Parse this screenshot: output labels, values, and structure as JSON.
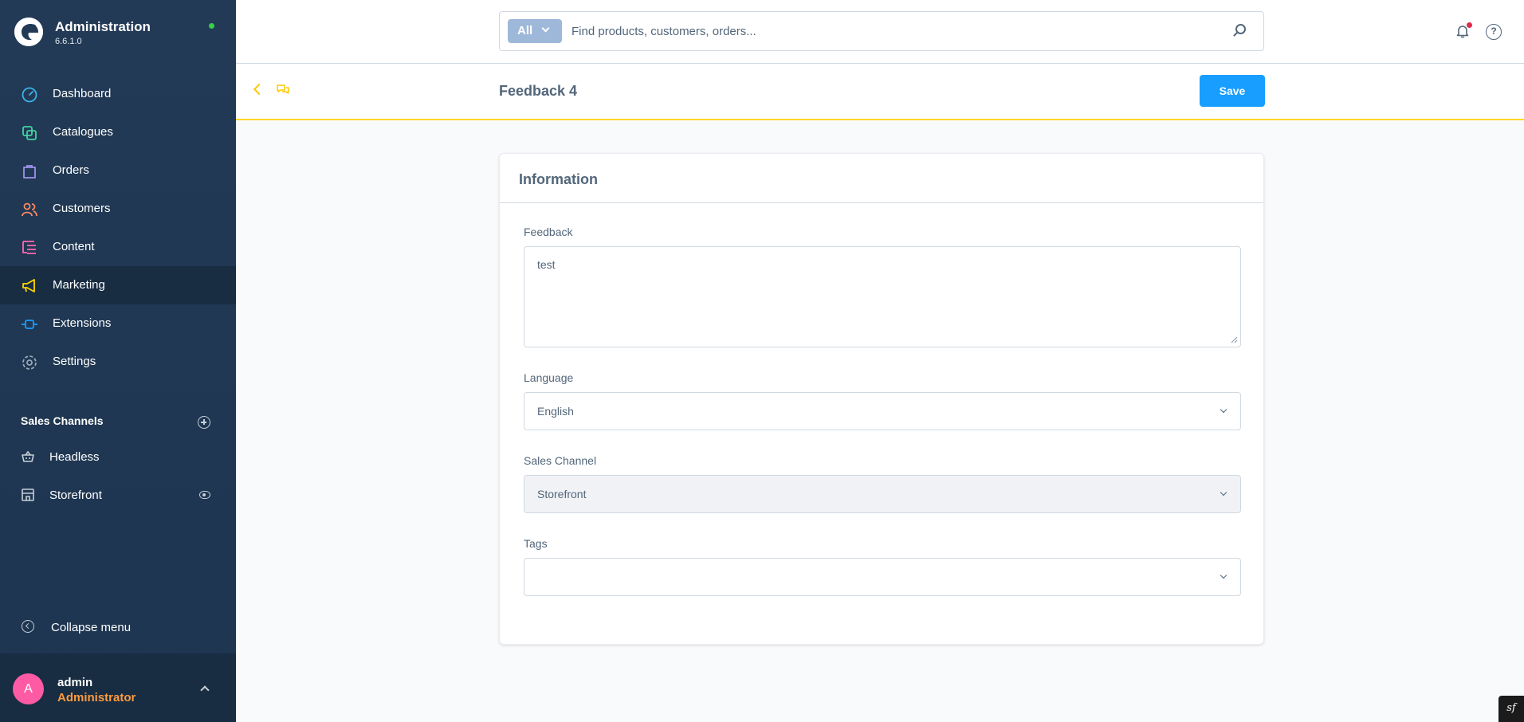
{
  "app": {
    "title": "Administration",
    "version": "6.6.1.0"
  },
  "nav": [
    {
      "label": "Dashboard",
      "icon": "dashboard-icon"
    },
    {
      "label": "Catalogues",
      "icon": "catalogues-icon"
    },
    {
      "label": "Orders",
      "icon": "orders-icon"
    },
    {
      "label": "Customers",
      "icon": "customers-icon"
    },
    {
      "label": "Content",
      "icon": "content-icon"
    },
    {
      "label": "Marketing",
      "icon": "marketing-icon",
      "active": true
    },
    {
      "label": "Extensions",
      "icon": "extensions-icon"
    },
    {
      "label": "Settings",
      "icon": "settings-icon"
    }
  ],
  "sales_channels": {
    "title": "Sales Channels",
    "items": [
      {
        "label": "Headless",
        "icon": "basket-icon"
      },
      {
        "label": "Storefront",
        "icon": "storefront-icon"
      }
    ]
  },
  "collapse_label": "Collapse menu",
  "user": {
    "initial": "A",
    "name": "admin",
    "role": "Administrator"
  },
  "search": {
    "type_label": "All",
    "placeholder": "Find products, customers, orders..."
  },
  "smartbar": {
    "title": "Feedback 4",
    "save_label": "Save"
  },
  "card": {
    "title": "Information",
    "feedback_label": "Feedback",
    "feedback_value": "test",
    "language_label": "Language",
    "language_value": "English",
    "sales_channel_label": "Sales Channel",
    "sales_channel_value": "Storefront",
    "tags_label": "Tags",
    "tags_value": ""
  },
  "colors": {
    "accent": "#189eff",
    "sidebar": "#223a56",
    "smartbar_border": "#ffd625",
    "avatar": "#ff5ba5",
    "role": "#ff9b3d"
  }
}
